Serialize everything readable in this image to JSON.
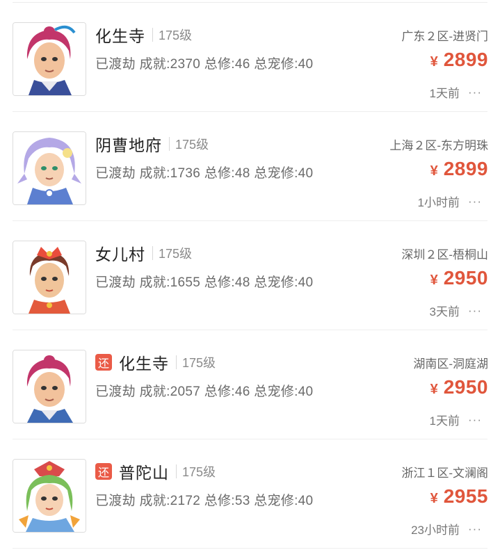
{
  "listings": [
    {
      "badge": "",
      "sect": "化生寺",
      "level": "175级",
      "stats": "已渡劫 成就:2370 总修:46 总宠修:40",
      "server": "广东２区-进贤门",
      "currency": "¥",
      "price": "2899",
      "time": "1天前",
      "more": "···",
      "avatar_icon": "huashengsi-character-avatar",
      "hair_color": "#c2356a"
    },
    {
      "badge": "",
      "sect": "阴曹地府",
      "level": "175级",
      "stats": "已渡劫 成就:1736 总修:48 总宠修:40",
      "server": "上海２区-东方明珠",
      "currency": "¥",
      "price": "2899",
      "time": "1小时前",
      "more": "···",
      "avatar_icon": "yincaodifu-character-avatar",
      "hair_color": "#b4a8e6"
    },
    {
      "badge": "",
      "sect": "女儿村",
      "level": "175级",
      "stats": "已渡劫 成就:1655 总修:48 总宠修:40",
      "server": "深圳２区-梧桐山",
      "currency": "¥",
      "price": "2950",
      "time": "3天前",
      "more": "···",
      "avatar_icon": "nuercun-character-avatar",
      "hair_color": "#7a3b2b"
    },
    {
      "badge": "还",
      "sect": "化生寺",
      "level": "175级",
      "stats": "已渡劫 成就:2057 总修:46 总宠修:40",
      "server": "湖南区-洞庭湖",
      "currency": "¥",
      "price": "2950",
      "time": "1天前",
      "more": "···",
      "avatar_icon": "huashengsi-character-avatar",
      "hair_color": "#c2356a"
    },
    {
      "badge": "还",
      "sect": "普陀山",
      "level": "175级",
      "stats": "已渡劫 成就:2172 总修:53 总宠修:40",
      "server": "浙江１区-文澜阁",
      "currency": "¥",
      "price": "2955",
      "time": "23小时前",
      "more": "···",
      "avatar_icon": "putuoshan-character-avatar",
      "hair_color": "#7bbf5a"
    }
  ],
  "colors": {
    "price": "#e0563c",
    "badge": "#ea5b47",
    "divider": "#eeeeee"
  }
}
